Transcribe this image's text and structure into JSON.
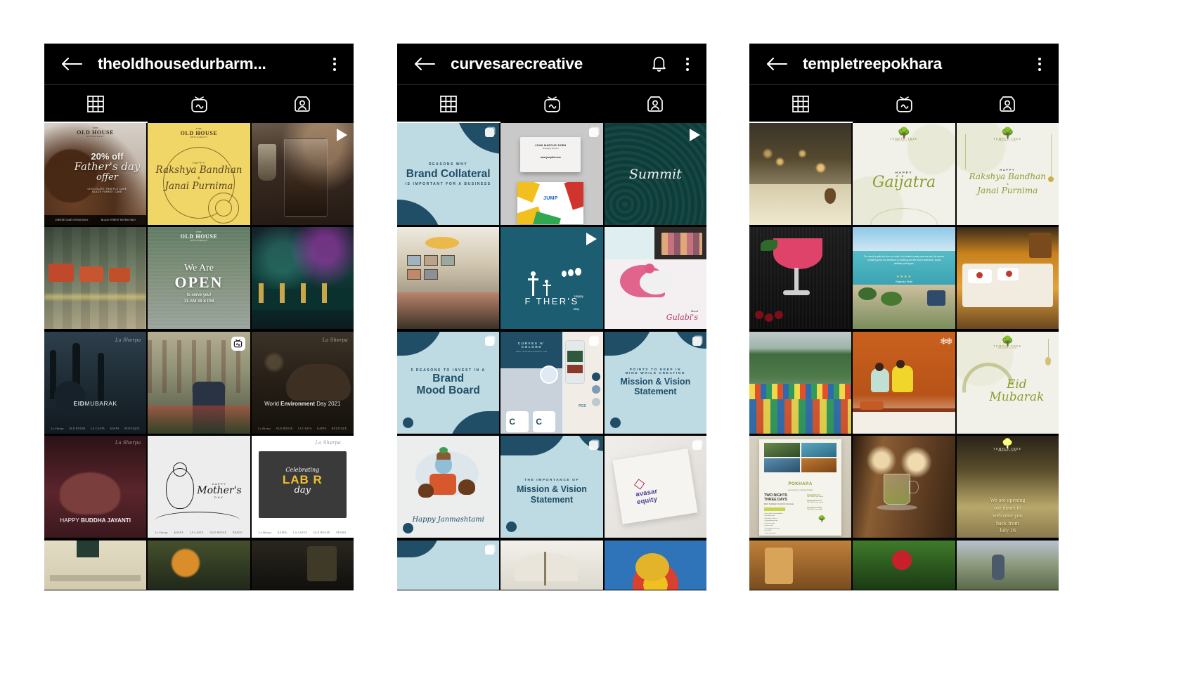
{
  "screenshot": {
    "background": "#ffffff",
    "phone_count": 3
  },
  "phones": [
    {
      "id": "phone-1",
      "header": {
        "back_icon": "back-arrow-icon",
        "title": "theoldhousedurbarm...",
        "has_bell": false,
        "bell_icon": "notification-bell-icon",
        "menu_icon": "overflow-menu-icon"
      },
      "tabs": [
        {
          "name": "grid",
          "icon": "grid-tab-icon",
          "selected": true
        },
        {
          "name": "igtv",
          "icon": "igtv-tab-icon",
          "selected": false
        },
        {
          "name": "tagged",
          "icon": "tagged-tab-icon",
          "selected": false
        }
      ],
      "posts": [
        {
          "name": "chocolate-cake-fathers-day-offer",
          "badge": "none",
          "kind": "cake-offer",
          "logo_t1": "THE",
          "logo_t2": "OLD HOUSE",
          "logo_t3": "RESTAURANT",
          "headline": "20% off",
          "script": "Father's day",
          "sub": "offer",
          "fine1": "CHOCOLATE TRUFFLE CAKE",
          "fine2": "BLACK FOREST CAKE",
          "bg": "#b9a392"
        },
        {
          "name": "rakshya-bandhan-janai-purnima-card",
          "badge": "none",
          "kind": "yellow-card",
          "logo_t1": "THE",
          "logo_t2": "OLD HOUSE",
          "logo_t3": "RESTAURANT",
          "small": "HAPPY",
          "line1": "Rakshya Bandhan",
          "amp": "&",
          "line2": "Janai Purnima",
          "bg": "#f0d667",
          "ink": "#5a4420"
        },
        {
          "name": "cocktail-pour-video",
          "badge": "reel",
          "kind": "photo-dark",
          "bg": "#3d2f26"
        },
        {
          "name": "restaurant-interior-seating",
          "badge": "none",
          "kind": "photo",
          "bg": "#4a5f52"
        },
        {
          "name": "we-are-open-announcement",
          "badge": "none",
          "kind": "open-card",
          "logo_t1": "THE",
          "logo_t2": "OLD HOUSE",
          "logo_t3": "RESTAURANT",
          "we": "We Are",
          "open": "OPEN",
          "serve": "to serve you!",
          "hours": "11 AM till 8 PM",
          "bg": "#6d7d6a"
        },
        {
          "name": "bar-lounge-night",
          "badge": "none",
          "kind": "photo",
          "bg": "#1d2b33"
        },
        {
          "name": "eid-mubarak-post",
          "badge": "none",
          "kind": "dark-poster",
          "caption_bold": "EID",
          "caption_rest": "MUBARAK",
          "bg": "#23313b"
        },
        {
          "name": "waiter-table-setup-photo",
          "badge": "igtv",
          "kind": "photo",
          "bg": "#7b7a5e"
        },
        {
          "name": "world-environment-day-2021",
          "badge": "none",
          "kind": "dark-poster",
          "caption_pre": "World ",
          "caption_bold": "Environment",
          "caption_post": " Day 2021",
          "bg": "#2b241c"
        },
        {
          "name": "happy-buddha-jayanti-post",
          "badge": "none",
          "kind": "dark-poster",
          "caption_pre": "HAPPY ",
          "caption_bold": "BUDDHA JAYANTI",
          "bg": "#3a1b20"
        },
        {
          "name": "happy-mothers-day-post",
          "badge": "none",
          "kind": "light-poster",
          "small": "HAPPY",
          "script": "Mother's",
          "sub": "DAY",
          "bg": "#ededed"
        },
        {
          "name": "celebrating-labor-day-post",
          "badge": "none",
          "kind": "labor-card",
          "script": "Celebrating",
          "big": "LAB R",
          "sub": "day",
          "bg": "#ffffff"
        },
        {
          "name": "beige-announcement-partial",
          "badge": "none",
          "kind": "photo",
          "bg": "#ddd6bd"
        },
        {
          "name": "food-plating-photo",
          "badge": "none",
          "kind": "photo",
          "bg": "#2f3a22"
        },
        {
          "name": "plant-dark-photo",
          "badge": "none",
          "kind": "photo",
          "bg": "#1b1a16"
        }
      ]
    },
    {
      "id": "phone-2",
      "header": {
        "back_icon": "back-arrow-icon",
        "title": "curvesarecreative",
        "has_bell": true,
        "bell_icon": "notification-bell-icon",
        "menu_icon": "overflow-menu-icon"
      },
      "tabs": [
        {
          "name": "grid",
          "icon": "grid-tab-icon",
          "selected": true
        },
        {
          "name": "igtv",
          "icon": "igtv-tab-icon",
          "selected": false
        },
        {
          "name": "tagged",
          "icon": "tagged-tab-icon",
          "selected": false
        }
      ],
      "posts": [
        {
          "name": "brand-collateral-carousel",
          "badge": "multi",
          "kind": "c-text",
          "small": "REASONS WHY",
          "big": "Brand Collateral",
          "sub": "IS IMPORTANT FOR A BUSINESS",
          "bg": "#bedbe4",
          "ink": "#1f4e66"
        },
        {
          "name": "business-card-mockup-carousel",
          "badge": "multi",
          "kind": "card-mockup",
          "card_name": "JOHN MARCUS DOEN",
          "card_role": "Managing Director",
          "card_web": "www.jumplink.com",
          "brand": "JUMP",
          "bg": "#c9c9c9"
        },
        {
          "name": "summit-logo-reel",
          "badge": "reel",
          "kind": "summit",
          "script": "Summit",
          "bg": "#0d3d3a"
        },
        {
          "name": "restaurant-group-dining-photo",
          "badge": "none",
          "kind": "photo",
          "bg": "#8a8070"
        },
        {
          "name": "happy-fathers-day-reel",
          "badge": "reel",
          "kind": "fathers",
          "happy": "Happy",
          "big": "F THER'S",
          "day": "Day",
          "bg": "#1d5d72"
        },
        {
          "name": "makeup-brand-moodboard",
          "badge": "none",
          "kind": "photo",
          "script": "Gulabi's",
          "small": "Mood",
          "bg": "#f2eef0"
        },
        {
          "name": "brand-mood-board-carousel",
          "badge": "multi",
          "kind": "c-text",
          "small": "5 REASONS TO INVEST IN A",
          "big1": "Brand",
          "big2": "Mood Board",
          "bg": "#bedbe4",
          "ink": "#1f4e66"
        },
        {
          "name": "curves-n-colors-mockup-carousel",
          "badge": "multi",
          "kind": "cnc",
          "t1": "CURVES N'",
          "t2": "COLORS",
          "web": "www.curvesarecreative.com",
          "pos": "POS",
          "bg": "#e9eef2"
        },
        {
          "name": "mission-vision-statement-carousel",
          "badge": "multi",
          "kind": "c-text",
          "small": "POINTS TO KEEP IN",
          "small2": "MIND WHILE CREATING",
          "big1": "Mission & Vision",
          "big2": "Statement",
          "bg": "#bedbe4",
          "ink": "#1f4e66"
        },
        {
          "name": "happy-janmashtami-post",
          "badge": "none",
          "kind": "janmashtami",
          "script": "Happy Janmashtami",
          "bg": "#eceeee"
        },
        {
          "name": "importance-mission-vision-carousel",
          "badge": "multi",
          "kind": "c-text",
          "small": "THE IMPORTANCE OF",
          "big1": "Mission & Vision",
          "big2": "Statement",
          "bg": "#bedbe4",
          "ink": "#1f4e66"
        },
        {
          "name": "avasar-equity-logo-mockup",
          "badge": "multi",
          "kind": "avasar",
          "t1": "avasar",
          "t2": "equity",
          "bg": "#e8e6e3"
        },
        {
          "name": "light-blue-wave-partial",
          "badge": "multi",
          "kind": "c-text",
          "bg": "#bedbe4",
          "ink": "#1f4e66"
        },
        {
          "name": "dried-flowers-neutral-partial",
          "badge": "none",
          "kind": "photo",
          "bg": "#e3e1da"
        },
        {
          "name": "festival-mandala-partial",
          "badge": "none",
          "kind": "photo",
          "bg": "#2f74b8"
        }
      ]
    },
    {
      "id": "phone-3",
      "header": {
        "back_icon": "back-arrow-icon",
        "title": "templetreepokhara",
        "has_bell": false,
        "bell_icon": "notification-bell-icon",
        "menu_icon": "overflow-menu-icon"
      },
      "tabs": [
        {
          "name": "grid",
          "icon": "grid-tab-icon",
          "selected": true
        },
        {
          "name": "igtv",
          "icon": "igtv-tab-icon",
          "selected": false
        },
        {
          "name": "tagged",
          "icon": "tagged-tab-icon",
          "selected": false
        }
      ],
      "posts": [
        {
          "name": "evening-dining-lights-photo",
          "badge": "none",
          "kind": "photo",
          "bg": "#2d2a20"
        },
        {
          "name": "happy-gaijatra-card",
          "badge": "none",
          "kind": "tt-card",
          "brand": "TEMPLE TREE",
          "brand_sub": "RESORT & SPA",
          "small": "HAPPY",
          "script": "Gaijatra",
          "bg": "#f2f1e9",
          "ink": "#8f9b31"
        },
        {
          "name": "rakshya-bandhan-janai-purnima-card",
          "badge": "none",
          "kind": "tt-card",
          "brand": "TEMPLE TREE",
          "brand_sub": "RESORT & SPA",
          "small": "HAPPY",
          "script": "Rakshya Bandhan",
          "amp": "&",
          "script2": "Janai Purnima",
          "bg": "#f2f1e9",
          "ink": "#8f9b31"
        },
        {
          "name": "cocktail-dessert-photo",
          "badge": "none",
          "kind": "photo",
          "bg": "#141414"
        },
        {
          "name": "pool-view-testimonial-card",
          "badge": "none",
          "kind": "pool",
          "stars": "★★★★",
          "name_label": "Rajendra Shah",
          "bg": "#4fb7c4"
        },
        {
          "name": "spa-massage-room-photo",
          "badge": "none",
          "kind": "photo",
          "bg": "#c98424"
        },
        {
          "name": "phewa-lake-boats-photo",
          "badge": "none",
          "kind": "photo",
          "bg": "#4d7c52"
        },
        {
          "name": "guests-in-room-photo",
          "badge": "none",
          "kind": "photo",
          "bg": "#c05a1d"
        },
        {
          "name": "eid-mubarak-card",
          "badge": "none",
          "kind": "tt-card",
          "brand": "TEMPLE TREE",
          "brand_sub": "RESORT & SPA",
          "script": "Eid",
          "script2": "Mubarak",
          "bg": "#f2f1e9",
          "ink": "#8f9b31"
        },
        {
          "name": "pokhara-two-nights-package-flyer",
          "badge": "none",
          "kind": "flyer",
          "title": "POKHARA",
          "sub": "get-away in a natural holiday",
          "l1": "TWO NIGHTS",
          "l2": "THREE DAYS",
          "l3": "BEST SUMMER VACATION PACKAGE",
          "bg": "#efeee6"
        },
        {
          "name": "herbal-tea-glass-photo",
          "badge": "none",
          "kind": "photo",
          "bg": "#6b4a2a"
        },
        {
          "name": "we-are-opening-announcement",
          "badge": "none",
          "kind": "opening",
          "brand": "TEMPLE TREE",
          "brand_sub": "RESORT & SPA",
          "l1": "We are opening",
          "l2": "our doors to",
          "l3": "welcome you",
          "l4": "back from",
          "l5": "July 16",
          "bg": "#8a7a4e"
        },
        {
          "name": "resort-walkway-partial",
          "badge": "none",
          "kind": "photo",
          "bg": "#a86a2d"
        },
        {
          "name": "red-flower-garden-partial",
          "badge": "none",
          "kind": "photo",
          "bg": "#244c1e"
        },
        {
          "name": "child-outdoor-partial",
          "badge": "none",
          "kind": "photo",
          "bg": "#8e9a7e"
        }
      ]
    }
  ]
}
